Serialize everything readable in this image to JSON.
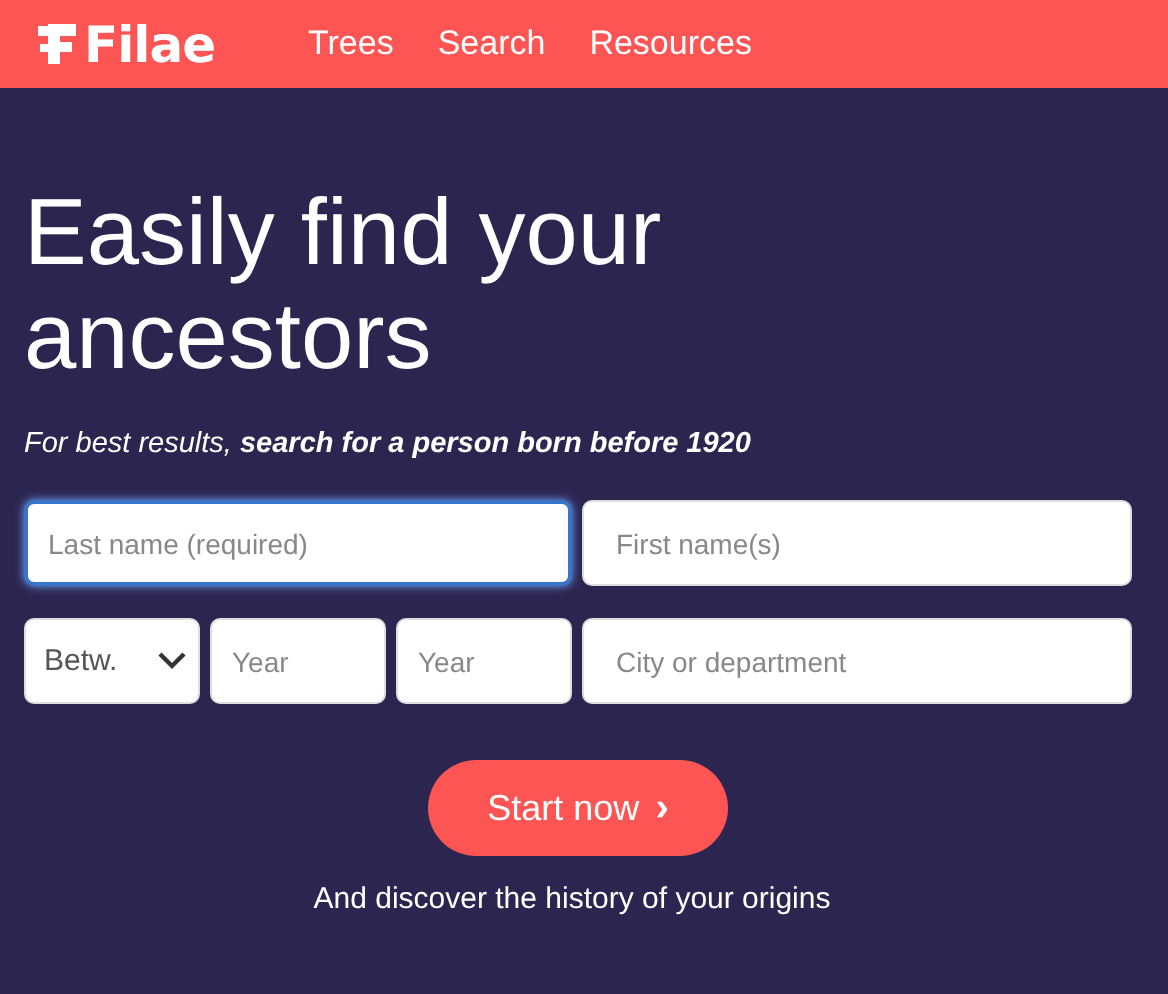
{
  "header": {
    "logo": "Filae",
    "nav": [
      {
        "label": "Trees"
      },
      {
        "label": "Search"
      },
      {
        "label": "Resources"
      }
    ]
  },
  "hero": {
    "title": "Easily find your ancestors",
    "subtitle": "For best results, **search for a person born before 1920**"
  },
  "form": {
    "fields": [
      {
        "kind": "wide",
        "placeholder": "Last name (required)",
        "focused": true
      },
      {
        "kind": "wide",
        "placeholder": "First name(s)",
        "focused": false
      },
      {
        "kind": "select",
        "value": "Betw.",
        "focused": false
      },
      {
        "kind": "year",
        "placeholder": "Year",
        "focused": false
      },
      {
        "kind": "year",
        "placeholder": "Year",
        "focused": false
      },
      {
        "kind": "text",
        "placeholder": "City or department",
        "focused": false
      }
    ]
  },
  "button": {
    "label": "Start now",
    "icon": "›"
  },
  "caption": "And discover the history of your origins"
}
